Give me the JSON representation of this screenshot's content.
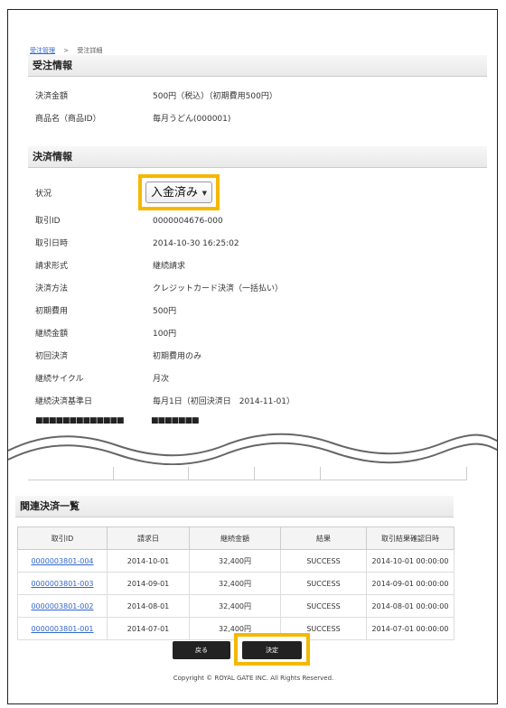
{
  "breadcrumb": {
    "parent": "受注管理",
    "separator": ">",
    "current": "受注詳細"
  },
  "order_info": {
    "title": "受注情報",
    "rows": [
      {
        "label": "決済金額",
        "value": "500円（税込）（初期費用500円）"
      },
      {
        "label": "商品名（商品ID）",
        "value": "毎月うどん(000001)"
      }
    ]
  },
  "payment_info": {
    "title": "決済情報",
    "status_label": "状況",
    "status_value": "入金済み",
    "rows": [
      {
        "label": "取引ID",
        "value": "0000004676-000"
      },
      {
        "label": "取引日時",
        "value": "2014-10-30 16:25:02"
      },
      {
        "label": "請求形式",
        "value": "継続請求"
      },
      {
        "label": "決済方法",
        "value": "クレジットカード決済（一括払い）"
      },
      {
        "label": "初期費用",
        "value": "500円"
      },
      {
        "label": "継続金額",
        "value": "100円"
      },
      {
        "label": "初回決済",
        "value": "初期費用のみ"
      },
      {
        "label": "継続サイクル",
        "value": "月次"
      },
      {
        "label": "継続決済基準日",
        "value": "毎月1日（初回決済日　2014-11-01）"
      }
    ],
    "masked_label": "■■■■■■■■■■■■■",
    "masked_value": "■■■■■■■"
  },
  "related": {
    "title": "関連決済一覧",
    "columns": [
      "取引ID",
      "請求日",
      "継続金額",
      "結果",
      "取引結果確認日時"
    ],
    "rows": [
      [
        "0000003801-004",
        "2014-10-01",
        "32,400円",
        "SUCCESS",
        "2014-10-01 00:00:00"
      ],
      [
        "0000003801-003",
        "2014-09-01",
        "32,400円",
        "SUCCESS",
        "2014-09-01 00:00:00"
      ],
      [
        "0000003801-002",
        "2014-08-01",
        "32,400円",
        "SUCCESS",
        "2014-08-01 00:00:00"
      ],
      [
        "0000003801-001",
        "2014-07-01",
        "32,400円",
        "SUCCESS",
        "2014-07-01 00:00:00"
      ]
    ]
  },
  "buttons": {
    "back": "戻る",
    "decide": "決定"
  },
  "footer": "Copyright © ROYAL GATE INC. All Rights Reserved.",
  "colors": {
    "highlight": "#f5b800",
    "link": "#3366cc",
    "button": "#222222"
  }
}
